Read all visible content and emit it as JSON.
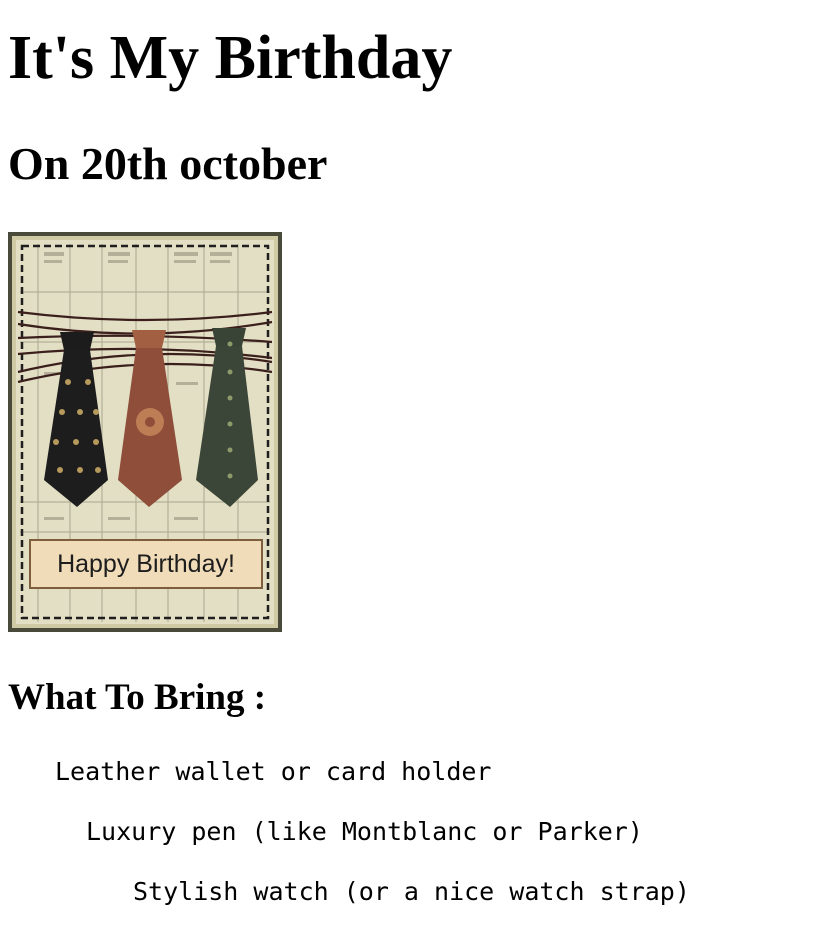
{
  "page": {
    "title": "It's My Birthday",
    "subtitle": "On 20th october",
    "card": {
      "label": "Happy Birthday!",
      "icon": "tie-card-image"
    },
    "bring_heading": "What To Bring :",
    "items": [
      "Leather wallet or card holder",
      "Luxury pen (like Montblanc or Parker)",
      "Stylish watch (or a nice watch strap)"
    ]
  }
}
